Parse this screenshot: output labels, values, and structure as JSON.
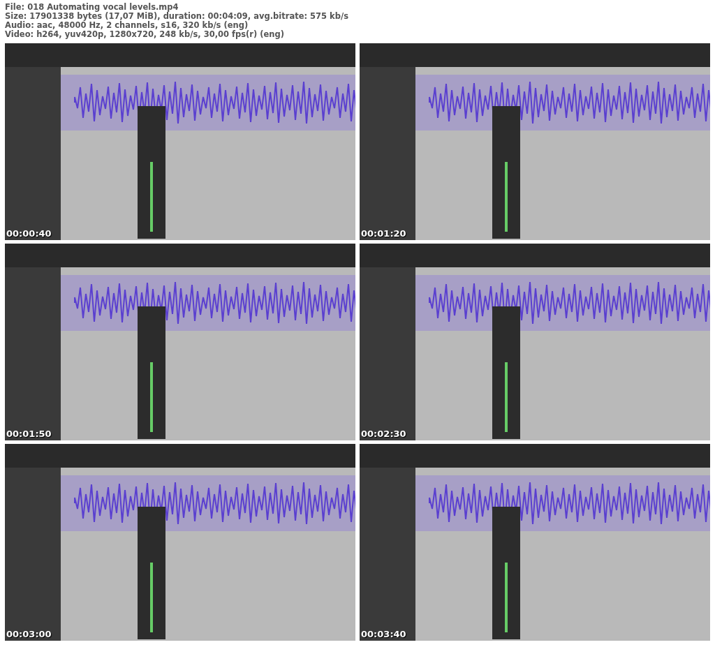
{
  "header": [
    "File: 018 Automating vocal levels.mp4",
    "Size: 17901338 bytes (17,07 MiB), duration: 00:04:09, avg.bitrate: 575 kb/s",
    "Audio: aac, 48000 Hz, 2 channels, s16, 320 kb/s (eng)",
    "Video: h264, yuv420p, 1280x720, 248 kb/s, 30,00 fps(r) (eng)"
  ],
  "frames": [
    {
      "timestamp": "00:00:40"
    },
    {
      "timestamp": "00:01:20"
    },
    {
      "timestamp": "00:01:50"
    },
    {
      "timestamp": "00:02:30"
    },
    {
      "timestamp": "00:03:00"
    },
    {
      "timestamp": "00:03:40"
    }
  ]
}
